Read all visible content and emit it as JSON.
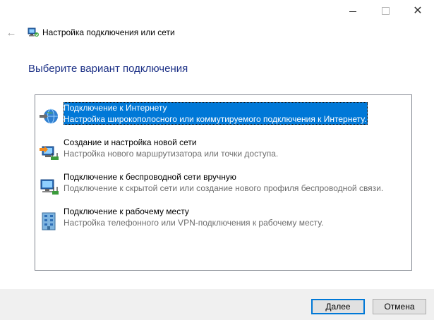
{
  "window": {
    "title": "Настройка подключения или сети",
    "controls": {
      "minimize": "minimize-icon",
      "maximize": "maximize-icon",
      "close": "✕"
    }
  },
  "header": {
    "back_icon": "←",
    "heading": "Выберите вариант подключения"
  },
  "options": [
    {
      "title": "Подключение к Интернету",
      "description": "Настройка широкополосного или коммутируемого подключения к Интернету.",
      "icon": "globe-network-icon",
      "selected": true
    },
    {
      "title": "Создание и настройка новой сети",
      "description": "Настройка нового маршрутизатора или точки доступа.",
      "icon": "new-network-icon",
      "selected": false
    },
    {
      "title": "Подключение к беспроводной сети вручную",
      "description": "Подключение к скрытой сети или создание нового профиля беспроводной связи.",
      "icon": "wireless-network-icon",
      "selected": false
    },
    {
      "title": "Подключение к рабочему месту",
      "description": "Настройка телефонного или VPN-подключения к рабочему месту.",
      "icon": "workplace-icon",
      "selected": false
    }
  ],
  "buttons": {
    "next": "Далее",
    "cancel": "Отмена"
  },
  "colors": {
    "accent": "#0078d7",
    "heading": "#1e3287",
    "footer_bg": "#f0f0f0"
  }
}
